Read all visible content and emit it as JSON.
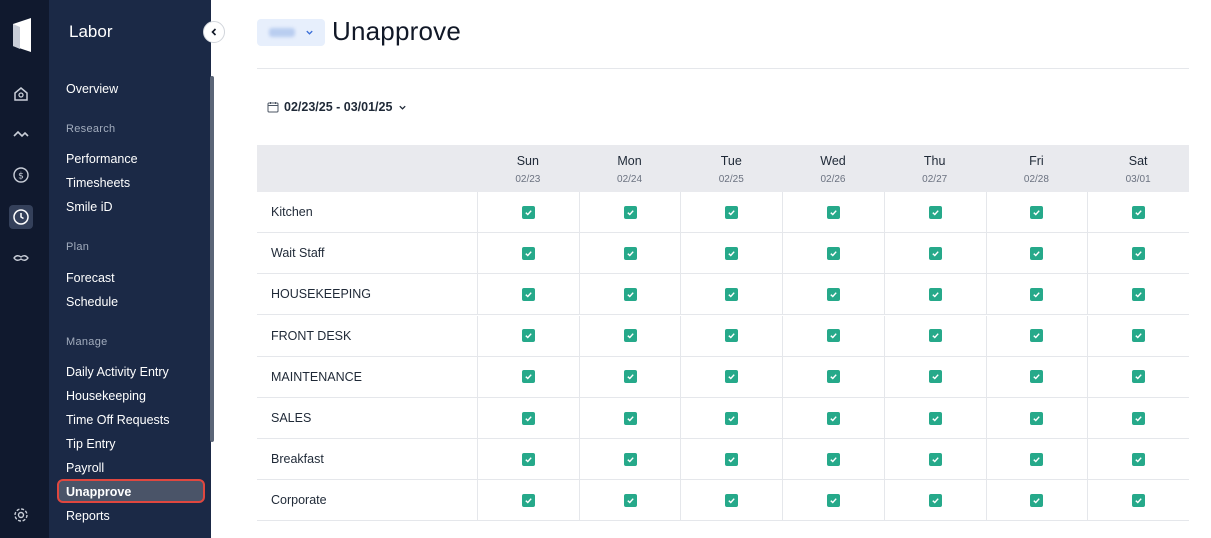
{
  "colors": {
    "rail_bg": "#10192e",
    "sidebar_bg": "#1b2946",
    "active_item_border": "#e0473f",
    "checkbox_green": "#26a98a",
    "header_bg": "#e9eaee"
  },
  "rail": {
    "icons": [
      "logo-icon",
      "home-icon",
      "activity-icon",
      "dollar-icon",
      "clock-icon",
      "handshake-icon",
      "gear-icon"
    ]
  },
  "sidebar": {
    "title": "Labor",
    "items": {
      "overview": "Overview",
      "research_header": "Research",
      "performance": "Performance",
      "timesheets": "Timesheets",
      "smile_id": "Smile iD",
      "plan_header": "Plan",
      "forecast": "Forecast",
      "schedule": "Schedule",
      "manage_header": "Manage",
      "daily_activity_entry": "Daily Activity Entry",
      "housekeeping": "Housekeeping",
      "time_off_requests": "Time Off Requests",
      "tip_entry": "Tip Entry",
      "payroll": "Payroll",
      "unapprove": "Unapprove",
      "reports": "Reports"
    }
  },
  "main": {
    "title": "Unapprove",
    "date_range": "02/23/25 - 03/01/25"
  },
  "grid": {
    "days": [
      {
        "name": "Sun",
        "date": "02/23"
      },
      {
        "name": "Mon",
        "date": "02/24"
      },
      {
        "name": "Tue",
        "date": "02/25"
      },
      {
        "name": "Wed",
        "date": "02/26"
      },
      {
        "name": "Thu",
        "date": "02/27"
      },
      {
        "name": "Fri",
        "date": "02/28"
      },
      {
        "name": "Sat",
        "date": "03/01"
      }
    ],
    "rows": [
      {
        "label": "Kitchen",
        "checked": [
          true,
          true,
          true,
          true,
          true,
          true,
          true
        ]
      },
      {
        "label": "Wait Staff",
        "checked": [
          true,
          true,
          true,
          true,
          true,
          true,
          true
        ]
      },
      {
        "label": "HOUSEKEEPING",
        "checked": [
          true,
          true,
          true,
          true,
          true,
          true,
          true
        ]
      },
      {
        "label": "FRONT DESK",
        "checked": [
          true,
          true,
          true,
          true,
          true,
          true,
          true
        ]
      },
      {
        "label": "MAINTENANCE",
        "checked": [
          true,
          true,
          true,
          true,
          true,
          true,
          true
        ]
      },
      {
        "label": "SALES",
        "checked": [
          true,
          true,
          true,
          true,
          true,
          true,
          true
        ]
      },
      {
        "label": "Breakfast",
        "checked": [
          true,
          true,
          true,
          true,
          true,
          true,
          true
        ]
      },
      {
        "label": "Corporate",
        "checked": [
          true,
          true,
          true,
          true,
          true,
          true,
          true
        ]
      }
    ]
  }
}
